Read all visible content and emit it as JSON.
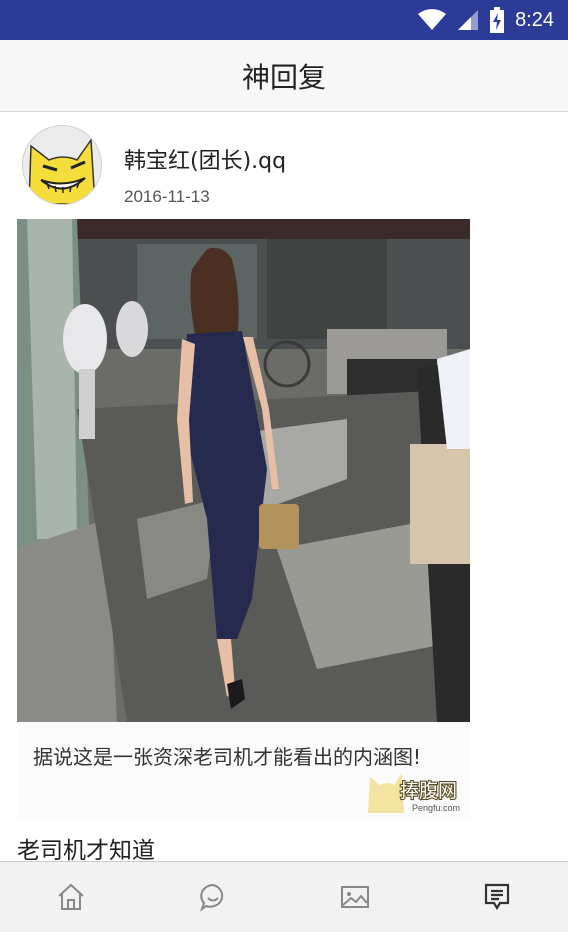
{
  "status_bar": {
    "time": "8:24",
    "icons": [
      "wifi-icon",
      "cell-signal-icon",
      "battery-charging-icon"
    ],
    "background": "#2c3a98"
  },
  "header": {
    "title": "神回复"
  },
  "post": {
    "author": "韩宝红(团长).qq",
    "date": "2016-11-13",
    "image": {
      "caption": "据说这是一张资深老司机才能看出的内涵图!",
      "watermark": "捧腹网",
      "watermark_url": "Pengfu.com"
    },
    "text": "老司机才知道"
  },
  "bottom_nav": {
    "tabs": [
      {
        "icon": "home-icon",
        "active": false
      },
      {
        "icon": "chat-icon",
        "active": false
      },
      {
        "icon": "image-icon",
        "active": false
      },
      {
        "icon": "document-icon",
        "active": true
      }
    ]
  }
}
